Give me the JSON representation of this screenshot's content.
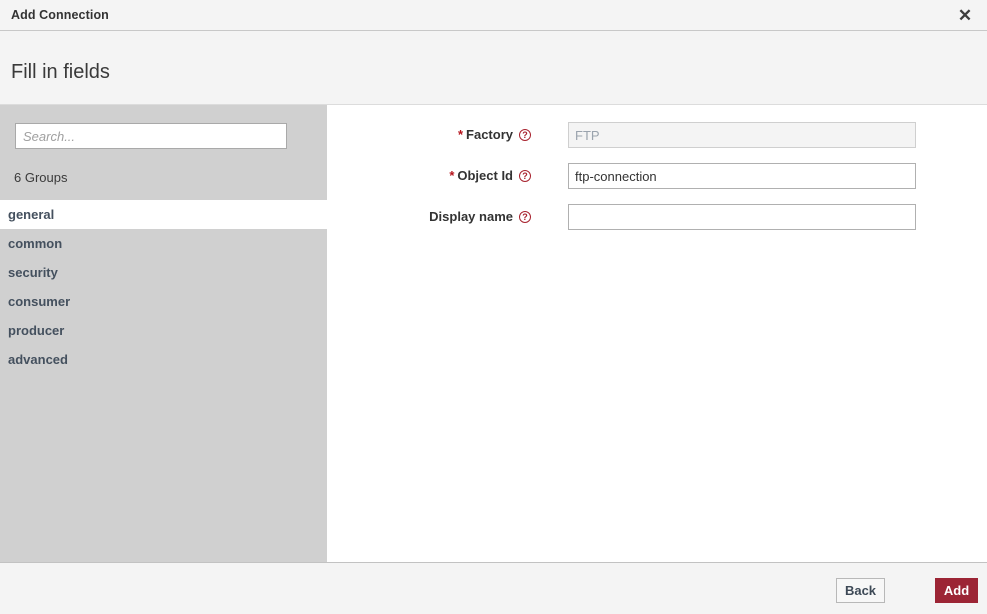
{
  "window": {
    "title": "Add Connection",
    "close_icon": "close-icon",
    "close_glyph": "✕"
  },
  "subheader": {
    "title": "Fill in fields"
  },
  "sidebar": {
    "search": {
      "placeholder": "Search...",
      "value": ""
    },
    "groups_count_label": "6 Groups",
    "items": [
      {
        "label": "general",
        "selected": true
      },
      {
        "label": "common",
        "selected": false
      },
      {
        "label": "security",
        "selected": false
      },
      {
        "label": "consumer",
        "selected": false
      },
      {
        "label": "producer",
        "selected": false
      },
      {
        "label": "advanced",
        "selected": false
      }
    ]
  },
  "form": {
    "required_marker": "*",
    "help_glyph": "?",
    "fields": [
      {
        "label": "Factory",
        "required": true,
        "value": "",
        "placeholder": "FTP",
        "disabled": true
      },
      {
        "label": "Object Id",
        "required": true,
        "value": "ftp-connection",
        "placeholder": "",
        "disabled": false
      },
      {
        "label": "Display name",
        "required": false,
        "value": "",
        "placeholder": "",
        "disabled": false
      }
    ]
  },
  "footer": {
    "back_label": "Back",
    "add_label": "Add"
  },
  "colors": {
    "accent": "#9c2535",
    "required_star": "#b5121b",
    "help_icon": "#a8232f",
    "sidebar_bg": "#d0d0d0",
    "header_bg": "#f4f4f4"
  }
}
